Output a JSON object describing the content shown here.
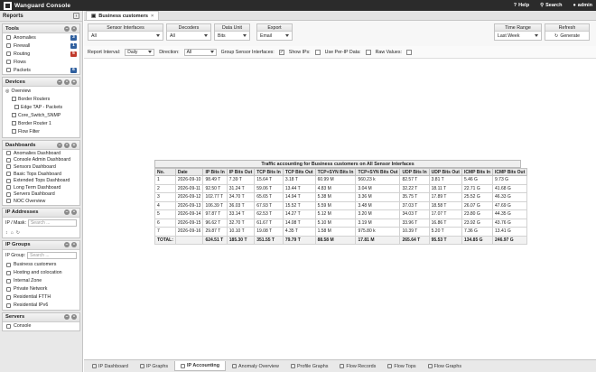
{
  "header": {
    "brand": "Wanguard Console",
    "help": "Help",
    "search": "Search",
    "user": "admin"
  },
  "sidebar": {
    "title": "Reports",
    "tools": {
      "title": "Tools",
      "items": [
        {
          "label": "Anomalies",
          "badge": "3",
          "color": "#2f5f9e"
        },
        {
          "label": "Firewall",
          "badge": "1",
          "color": "#2f5f9e"
        },
        {
          "label": "Routing",
          "badge": "5",
          "color": "#c0392b"
        },
        {
          "label": "Flows",
          "badge": "",
          "color": ""
        },
        {
          "label": "Packets",
          "badge": "6",
          "color": "#2f5f9e"
        }
      ]
    },
    "devices": {
      "title": "Devices",
      "items": [
        "Overview",
        "Border Routers",
        "Edge TAP - Packets",
        "Core_Switch_SNMP",
        "Border Router 1",
        "Flow Filter"
      ]
    },
    "dashboards": {
      "title": "Dashboards",
      "items": [
        "Anomalies Dashboard",
        "Console Admin Dashboard",
        "Sensors Dashboard",
        "Basic Tops Dashboard",
        "Extended Tops Dashboard",
        "Long Term Dashboard",
        "Servers Dashboard",
        "NOC Overview"
      ]
    },
    "ip_addresses": {
      "title": "IP Addresses",
      "label": "IP / Mask:",
      "placeholder": "Search ..."
    },
    "ip_groups": {
      "title": "IP Groups",
      "label": "IP Group:",
      "placeholder": "Search ...",
      "items": [
        "Business customers",
        "Hosting and colocation",
        "Internal Zone",
        "Private Network",
        "Residential FTTH",
        "Residential IPv6"
      ]
    },
    "servers": {
      "title": "Servers",
      "items": [
        "Console"
      ]
    }
  },
  "tab": {
    "label": "Business customers"
  },
  "filters": {
    "sensor_interfaces": {
      "title": "Sensor Interfaces",
      "value": "All"
    },
    "decoders": {
      "title": "Decoders",
      "value": "All"
    },
    "data_unit": {
      "title": "Data Unit",
      "value": "Bits"
    },
    "export": {
      "title": "Export",
      "value": "Email"
    },
    "time_range": {
      "title": "Time Range",
      "value": "Last Week"
    },
    "refresh": {
      "title": "Refresh",
      "value": "Generate"
    }
  },
  "options": {
    "report_interval_label": "Report Interval:",
    "report_interval": "Daily",
    "direction_label": "Direction:",
    "direction": "All",
    "group_sensor_label": "Group Sensor Interfaces:",
    "show_ips_label": "Show IPs:",
    "use_per_ip_label": "Use Per-IP Data:",
    "raw_values_label": "Raw Values:"
  },
  "report": {
    "title": "Traffic accounting for Business customers on All Sensor Interfaces",
    "columns": [
      "No.",
      "Date",
      "IP Bits In",
      "IP Bits Out",
      "TCP Bits In",
      "TCP Bits Out",
      "TCP+SYN Bits In",
      "TCP+SYN Bits Out",
      "UDP Bits In",
      "UDP Bits Out",
      "ICMP Bits In",
      "ICMP Bits Out"
    ],
    "rows": [
      [
        "1",
        "2026-09-10",
        "98.49 T",
        "7.39 T",
        "15.64 T",
        "3.18 T",
        "60.99 M",
        "560.23 k",
        "82.57 T",
        "3.81 T",
        "5.46 G",
        "9.73 G"
      ],
      [
        "2",
        "2026-09-11",
        "92.50 T",
        "31.24 T",
        "59.06 T",
        "13.44 T",
        "4.83 M",
        "3.04 M",
        "32.22 T",
        "18.11 T",
        "22.71 G",
        "41.68 G"
      ],
      [
        "3",
        "2026-09-12",
        "102.77 T",
        "34.70 T",
        "65.65 T",
        "14.94 T",
        "5.38 M",
        "3.36 M",
        "35.75 T",
        "17.89 T",
        "25.52 G",
        "46.33 G"
      ],
      [
        "4",
        "2026-09-13",
        "106.39 T",
        "36.03 T",
        "67.93 T",
        "15.52 T",
        "5.59 M",
        "3.48 M",
        "37.03 T",
        "18.58 T",
        "26.07 G",
        "47.69 G"
      ],
      [
        "5",
        "2026-09-14",
        "97.87 T",
        "33.14 T",
        "62.53 T",
        "14.27 T",
        "5.12 M",
        "3.20 M",
        "34.03 T",
        "17.07 T",
        "23.80 G",
        "44.35 G"
      ],
      [
        "6",
        "2026-09-15",
        "96.62 T",
        "32.70 T",
        "61.67 T",
        "14.08 T",
        "5.10 M",
        "3.19 M",
        "33.96 T",
        "16.86 T",
        "23.92 G",
        "43.76 G"
      ],
      [
        "7",
        "2026-09-16",
        "29.87 T",
        "10.10 T",
        "19.08 T",
        "4.35 T",
        "1.58 M",
        "975.80 k",
        "10.39 T",
        "5.20 T",
        "7.36 G",
        "13.41 G"
      ]
    ],
    "total": [
      "TOTAL:",
      "",
      "624.51 T",
      "185.30 T",
      "351.55 T",
      "79.79 T",
      "88.58 M",
      "17.81 M",
      "265.64 T",
      "95.53 T",
      "134.85 G",
      "246.97 G"
    ]
  },
  "bottom_tabs": [
    "IP Dashboard",
    "IP Graphs",
    "IP Accounting",
    "Anomaly Overview",
    "Profile Graphs",
    "Flow Records",
    "Flow Tops",
    "Flow Graphs"
  ],
  "active_bottom_tab": "IP Accounting"
}
